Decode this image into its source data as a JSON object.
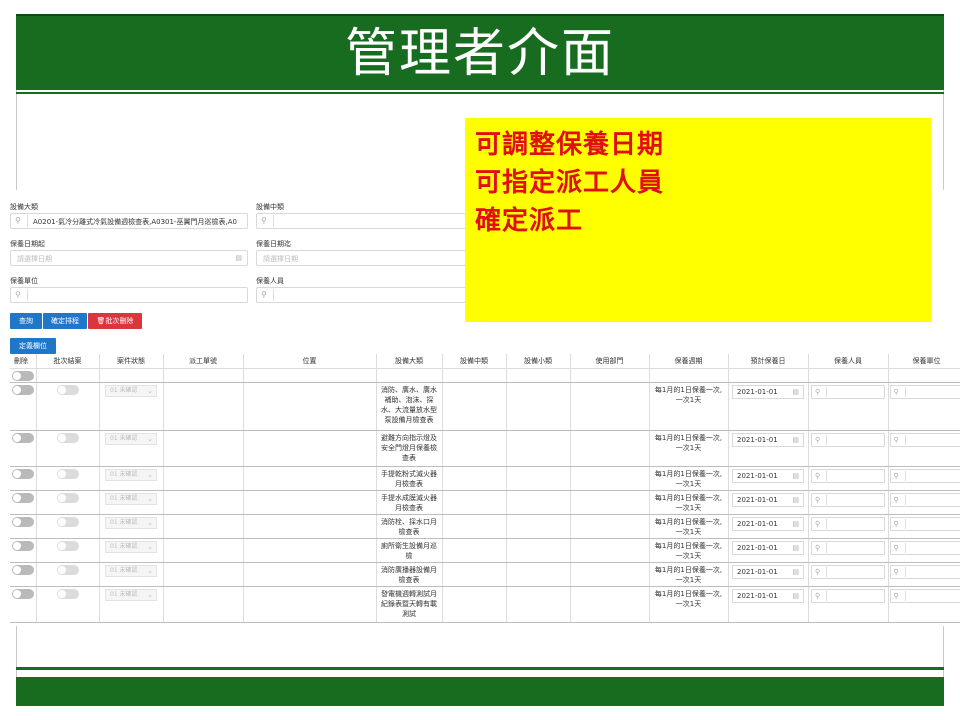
{
  "slide": {
    "title": "管理者介面",
    "note_lines": [
      "可調整保養日期",
      "可指定派工人員",
      "確定派工"
    ],
    "colors": {
      "title_bar": "#176c1f",
      "note_bg": "#ffff00",
      "note_text": "#e01010"
    }
  },
  "filters": {
    "equip_major_label": "設備大類",
    "equip_major_value": "A0201-氣冷分離式冷氣設備週檢查表,A0301-巫翼門月巡檢表,A0",
    "equip_mid_label": "設備中類",
    "date_start_label": "保養日期起",
    "date_start_placeholder": "請選擇日期",
    "date_end_label": "保養日期迄",
    "date_end_placeholder": "請選擇日期",
    "unit_label": "保養單位",
    "person_label": "保養人員"
  },
  "buttons": {
    "search": "查詢",
    "confirm_schedule": "確定排程",
    "batch_delete": "批次刪除",
    "fix_columns": "定義欄位"
  },
  "table": {
    "headers": [
      "刪除",
      "批次結案",
      "案件狀態",
      "派工單號",
      "位置",
      "設備大類",
      "設備中類",
      "設備小類",
      "使用部門",
      "保養週期",
      "預計保養日",
      "保養人員",
      "保養單位"
    ],
    "status_text": "01 未確認",
    "rows": [
      {
        "item": "消防、廣水、廣水補助、泡沫、採水、大流量放水型泵設備月檢查表",
        "period": "每1月的1日保養一次,一次1天",
        "date": "2021-01-01"
      },
      {
        "item": "避難方向指示燈及安全門燈月保養檢查表",
        "period": "每1月的1日保養一次,一次1天",
        "date": "2021-01-01"
      },
      {
        "item": "手提乾粉式滅火器月檢查表",
        "period": "每1月的1日保養一次,一次1天",
        "date": "2021-01-01"
      },
      {
        "item": "手提水成膜滅火器月檢查表",
        "period": "每1月的1日保養一次,一次1天",
        "date": "2021-01-01"
      },
      {
        "item": "消防栓、採水口月檢查表",
        "period": "每1月的1日保養一次,一次1天",
        "date": "2021-01-01"
      },
      {
        "item": "廁所衛生設備月巡檢",
        "period": "每1月的1日保養一次,一次1天",
        "date": "2021-01-01"
      },
      {
        "item": "消防廣播器設備月檢查表",
        "period": "每1月的1日保養一次,一次1天",
        "date": "2021-01-01"
      },
      {
        "item": "發電機週轉測試月紀錄表暨天轉有載測試",
        "period": "每1月的1日保養一次,一次1天",
        "date": "2021-01-01"
      }
    ]
  }
}
